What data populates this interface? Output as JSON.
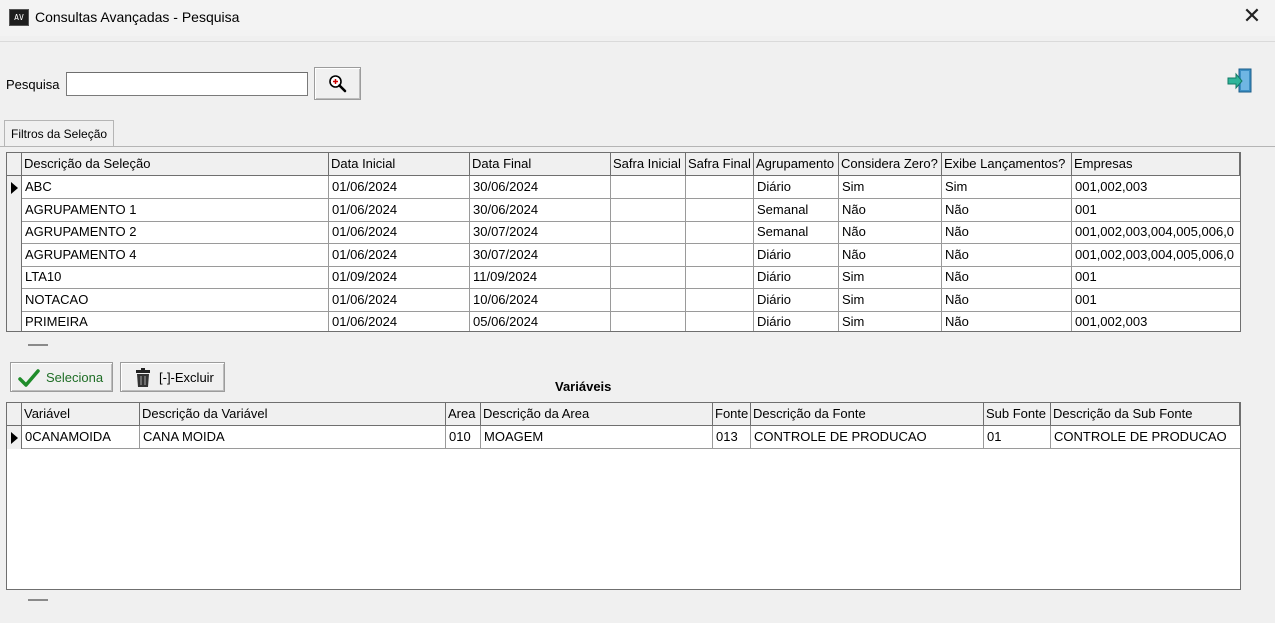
{
  "window": {
    "title": "Consultas Avançadas - Pesquisa",
    "close_glyph": "✕",
    "app_icon_text": "AV"
  },
  "search": {
    "label": "Pesquisa",
    "value": "",
    "button_icon": "zoom-in-icon"
  },
  "exit": {
    "icon": "exit-door-icon"
  },
  "tab": {
    "label": "Filtros da Seleção"
  },
  "filters_grid": {
    "columns": [
      "Descrição da Seleção",
      "Data Inicial",
      "Data Final",
      "Safra Inicial",
      "Safra Final",
      "Agrupamento",
      "Considera Zero?",
      "Exibe Lançamentos?",
      "Empresas"
    ],
    "rows": [
      [
        "ABC",
        "01/06/2024",
        "30/06/2024",
        "",
        "",
        "Diário",
        "Sim",
        "Sim",
        "001,002,003"
      ],
      [
        "AGRUPAMENTO 1",
        "01/06/2024",
        "30/06/2024",
        "",
        "",
        "Semanal",
        "Não",
        "Não",
        "001"
      ],
      [
        "AGRUPAMENTO 2",
        "01/06/2024",
        "30/07/2024",
        "",
        "",
        "Semanal",
        "Não",
        "Não",
        "001,002,003,004,005,006,0"
      ],
      [
        "AGRUPAMENTO 4",
        "01/06/2024",
        "30/07/2024",
        "",
        "",
        "Diário",
        "Não",
        "Não",
        "001,002,003,004,005,006,0"
      ],
      [
        "LTA10",
        "01/09/2024",
        "11/09/2024",
        "",
        "",
        "Diário",
        "Sim",
        "Não",
        "001"
      ],
      [
        "NOTACAO",
        "01/06/2024",
        "10/06/2024",
        "",
        "",
        "Diário",
        "Sim",
        "Não",
        "001"
      ],
      [
        "PRIMEIRA",
        "01/06/2024",
        "05/06/2024",
        "",
        "",
        "Diário",
        "Sim",
        "Não",
        "001,002,003"
      ]
    ],
    "selected_row": 0
  },
  "actions": {
    "select_label": "Seleciona",
    "delete_label": "[-]-Excluir"
  },
  "variables": {
    "title": "Variáveis",
    "columns": [
      "Variável",
      "Descrição da Variável",
      "Area",
      "Descrição da Area",
      "Fonte",
      "Descrição da Fonte",
      "Sub Fonte",
      "Descrição da Sub Fonte"
    ],
    "rows": [
      [
        "0CANAMOIDA",
        "CANA MOIDA",
        "010",
        "MOAGEM",
        "013",
        "CONTROLE DE PRODUCAO",
        "01",
        "CONTROLE DE PRODUCAO"
      ]
    ],
    "selected_row": 0
  },
  "colors": {
    "grid_border": "#6f6f6f",
    "check_green": "#1f8c2a"
  }
}
